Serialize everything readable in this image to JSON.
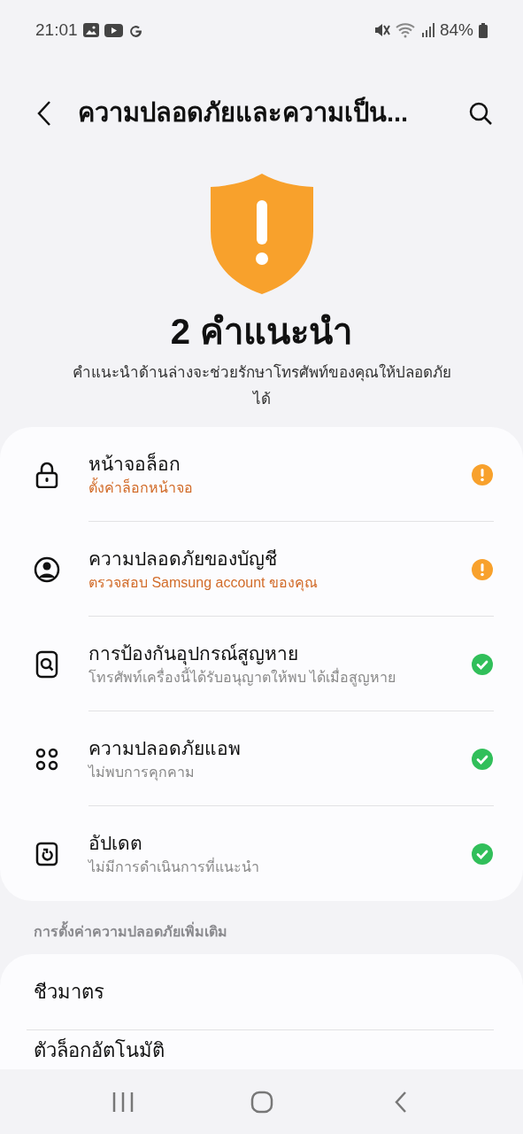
{
  "status_bar": {
    "time": "21:01",
    "battery": "84%"
  },
  "header": {
    "title": "ความปลอดภัยและความเป็น..."
  },
  "summary": {
    "needs_attention": true,
    "headline": "2 คำแนะนำ",
    "description": "คำแนะนำด้านล่างจะช่วยรักษาโทรศัพท์ของคุณให้ปลอดภัยได้"
  },
  "items": [
    {
      "title": "หน้าจอล็อก",
      "subtitle": "ตั้งค่าล็อกหน้าจอ",
      "needs_attention": true
    },
    {
      "title": "ความปลอดภัยของบัญชี",
      "subtitle": "ตรวจสอบ Samsung account ของคุณ",
      "needs_attention": true
    },
    {
      "title": "การป้องกันอุปกรณ์สูญหาย",
      "subtitle": "โทรศัพท์เครื่องนี้ได้รับอนุญาตให้พบ ได้เมื่อสูญหาย",
      "needs_attention": false
    },
    {
      "title": "ความปลอดภัยแอพ",
      "subtitle": "ไม่พบการคุกคาม",
      "needs_attention": false
    },
    {
      "title": "อัปเดต",
      "subtitle": "ไม่มีการดำเนินการที่แนะนำ",
      "needs_attention": false
    }
  ],
  "more_settings": {
    "heading": "การตั้งค่าความปลอดภัยเพิ่มเติม",
    "items": [
      "ชีวมาตร",
      "ตัวล็อกอัตโนมัติ"
    ]
  }
}
